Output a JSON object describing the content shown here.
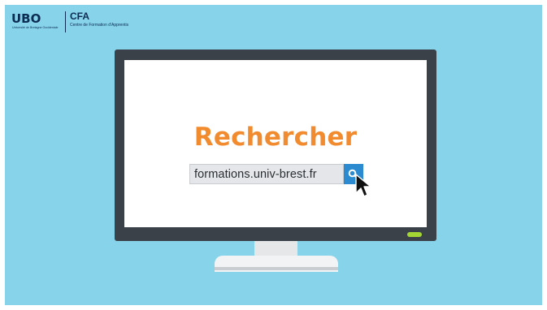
{
  "logo": {
    "brand": "UBO",
    "brand_subtitle": "Université de Bretagne Occidentale",
    "cfa_title": "CFA",
    "cfa_subtitle": "Centre de Formation d'Apprentis"
  },
  "screen": {
    "headline": "Rechercher",
    "search_value": "formations.univ-brest.fr"
  },
  "colors": {
    "background": "#86d3ea",
    "headline": "#f28a2e",
    "search_button": "#2c8bd0",
    "monitor": "#3a4148",
    "power_led": "#a4d634"
  },
  "icons": {
    "search": "search-icon",
    "cursor": "mouse-pointer-icon"
  }
}
